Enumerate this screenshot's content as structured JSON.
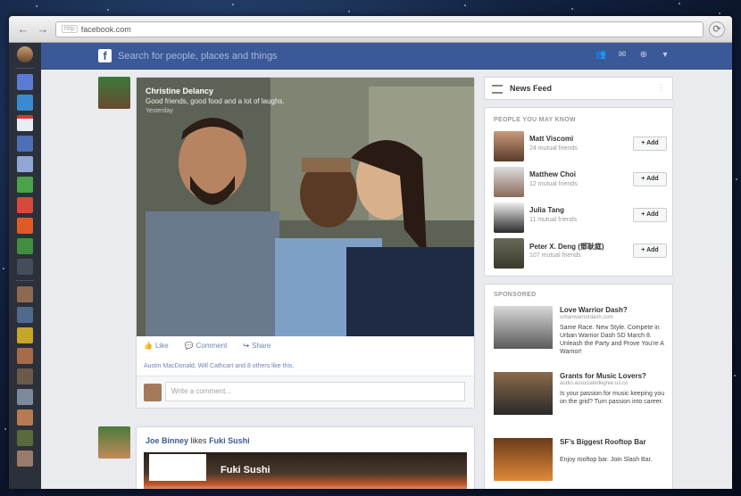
{
  "browser": {
    "url_prefix": "http",
    "url": "facebook.com",
    "back": "←",
    "forward": "→",
    "reload": "⟳"
  },
  "fb_bar": {
    "logo": "f",
    "search_placeholder": "Search for people, places and things"
  },
  "post1": {
    "author": "Christine Delancy",
    "caption": "Good friends, good food and a lot of laughs.",
    "sub": "Yesterday",
    "actions": {
      "like": "Like",
      "comment": "Comment",
      "share": "Share"
    },
    "likes_line": "Austin MacDonald, Will Cathcart and 8 others like this.",
    "comment_placeholder": "Write a comment..."
  },
  "post2": {
    "author": "Joe Binney",
    "verb": "likes",
    "page": "Fuki Sushi",
    "title": "Fuki Sushi"
  },
  "right": {
    "news_feed": "News Feed",
    "pymk_title": "PEOPLE YOU MAY KNOW",
    "people": [
      {
        "name": "Matt Viscomi",
        "mutual": "24 mutual friends",
        "add": "Add"
      },
      {
        "name": "Matthew Choi",
        "mutual": "12 mutual friends",
        "add": "Add"
      },
      {
        "name": "Julia Tang",
        "mutual": "11 mutual friends",
        "add": "Add"
      },
      {
        "name": "Peter X. Deng (鄧耿庭)",
        "mutual": "107 mutual friends",
        "add": "Add"
      }
    ],
    "sponsored_title": "SPONSORED",
    "ads": [
      {
        "title": "Love Warrior Dash?",
        "url": "urbanwarriordash.com",
        "desc": "Same Race. New Style. Compete in Urban Warrior Dash SD March 8. Unleash the Party and Prove You're A Warrior!"
      },
      {
        "title": "Grants for Music Lovers?",
        "url": "audio.associatedegree.us.co",
        "desc": "Is your passion for music keeping you on the grid? Turn passion into career."
      },
      {
        "title": "SF's Biggest Rooftop Bar",
        "url": "",
        "desc": "Enjoy rooftop bar. Join Slash Bar."
      }
    ]
  }
}
